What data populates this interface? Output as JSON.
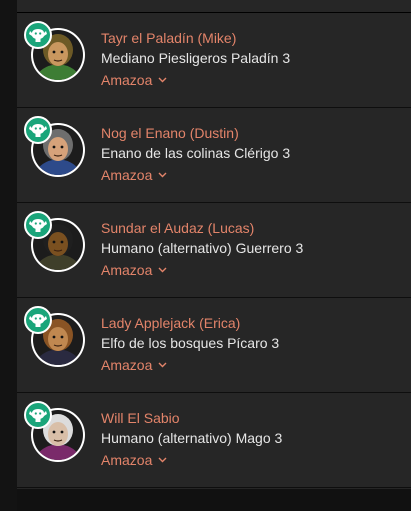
{
  "characters": [
    {
      "name": "Tayr el Paladín (Mike)",
      "description": "Mediano Piesligeros Paladín 3",
      "campaign": "Amazoa",
      "avatar_icon": "halfling-portrait-icon",
      "skin": "#c9975f",
      "hair": "#6d5a26",
      "garb": "#3d7d34"
    },
    {
      "name": "Nog el Enano (Dustin)",
      "description": "Enano de las colinas Clérigo 3",
      "campaign": "Amazoa",
      "avatar_icon": "dwarf-portrait-icon",
      "skin": "#d6a27a",
      "hair": "#6e6e6e",
      "garb": "#2d4a8a"
    },
    {
      "name": "Sundar el Audaz (Lucas)",
      "description": "Humano (alternativo) Guerrero 3",
      "campaign": "Amazoa",
      "avatar_icon": "warrior-portrait-icon",
      "skin": "#7a5020",
      "hair": "#1f1f1f",
      "garb": "#3f3f2a"
    },
    {
      "name": "Lady Applejack (Erica)",
      "description": "Elfo de los bosques Pícaro 3",
      "campaign": "Amazoa",
      "avatar_icon": "elf-portrait-icon",
      "skin": "#c08850",
      "hair": "#8a5424",
      "garb": "#2a2a40"
    },
    {
      "name": "Will El Sabio",
      "description": "Humano (alternativo) Mago 3",
      "campaign": "Amazoa",
      "avatar_icon": "wizard-portrait-icon",
      "skin": "#d9bfa8",
      "hair": "#dcdcdc",
      "garb": "#7a2a6a"
    }
  ],
  "colors": {
    "accent": "#e3846a",
    "badge": "#1aa57a",
    "text": "#e6e6e6",
    "panel": "#262626"
  }
}
